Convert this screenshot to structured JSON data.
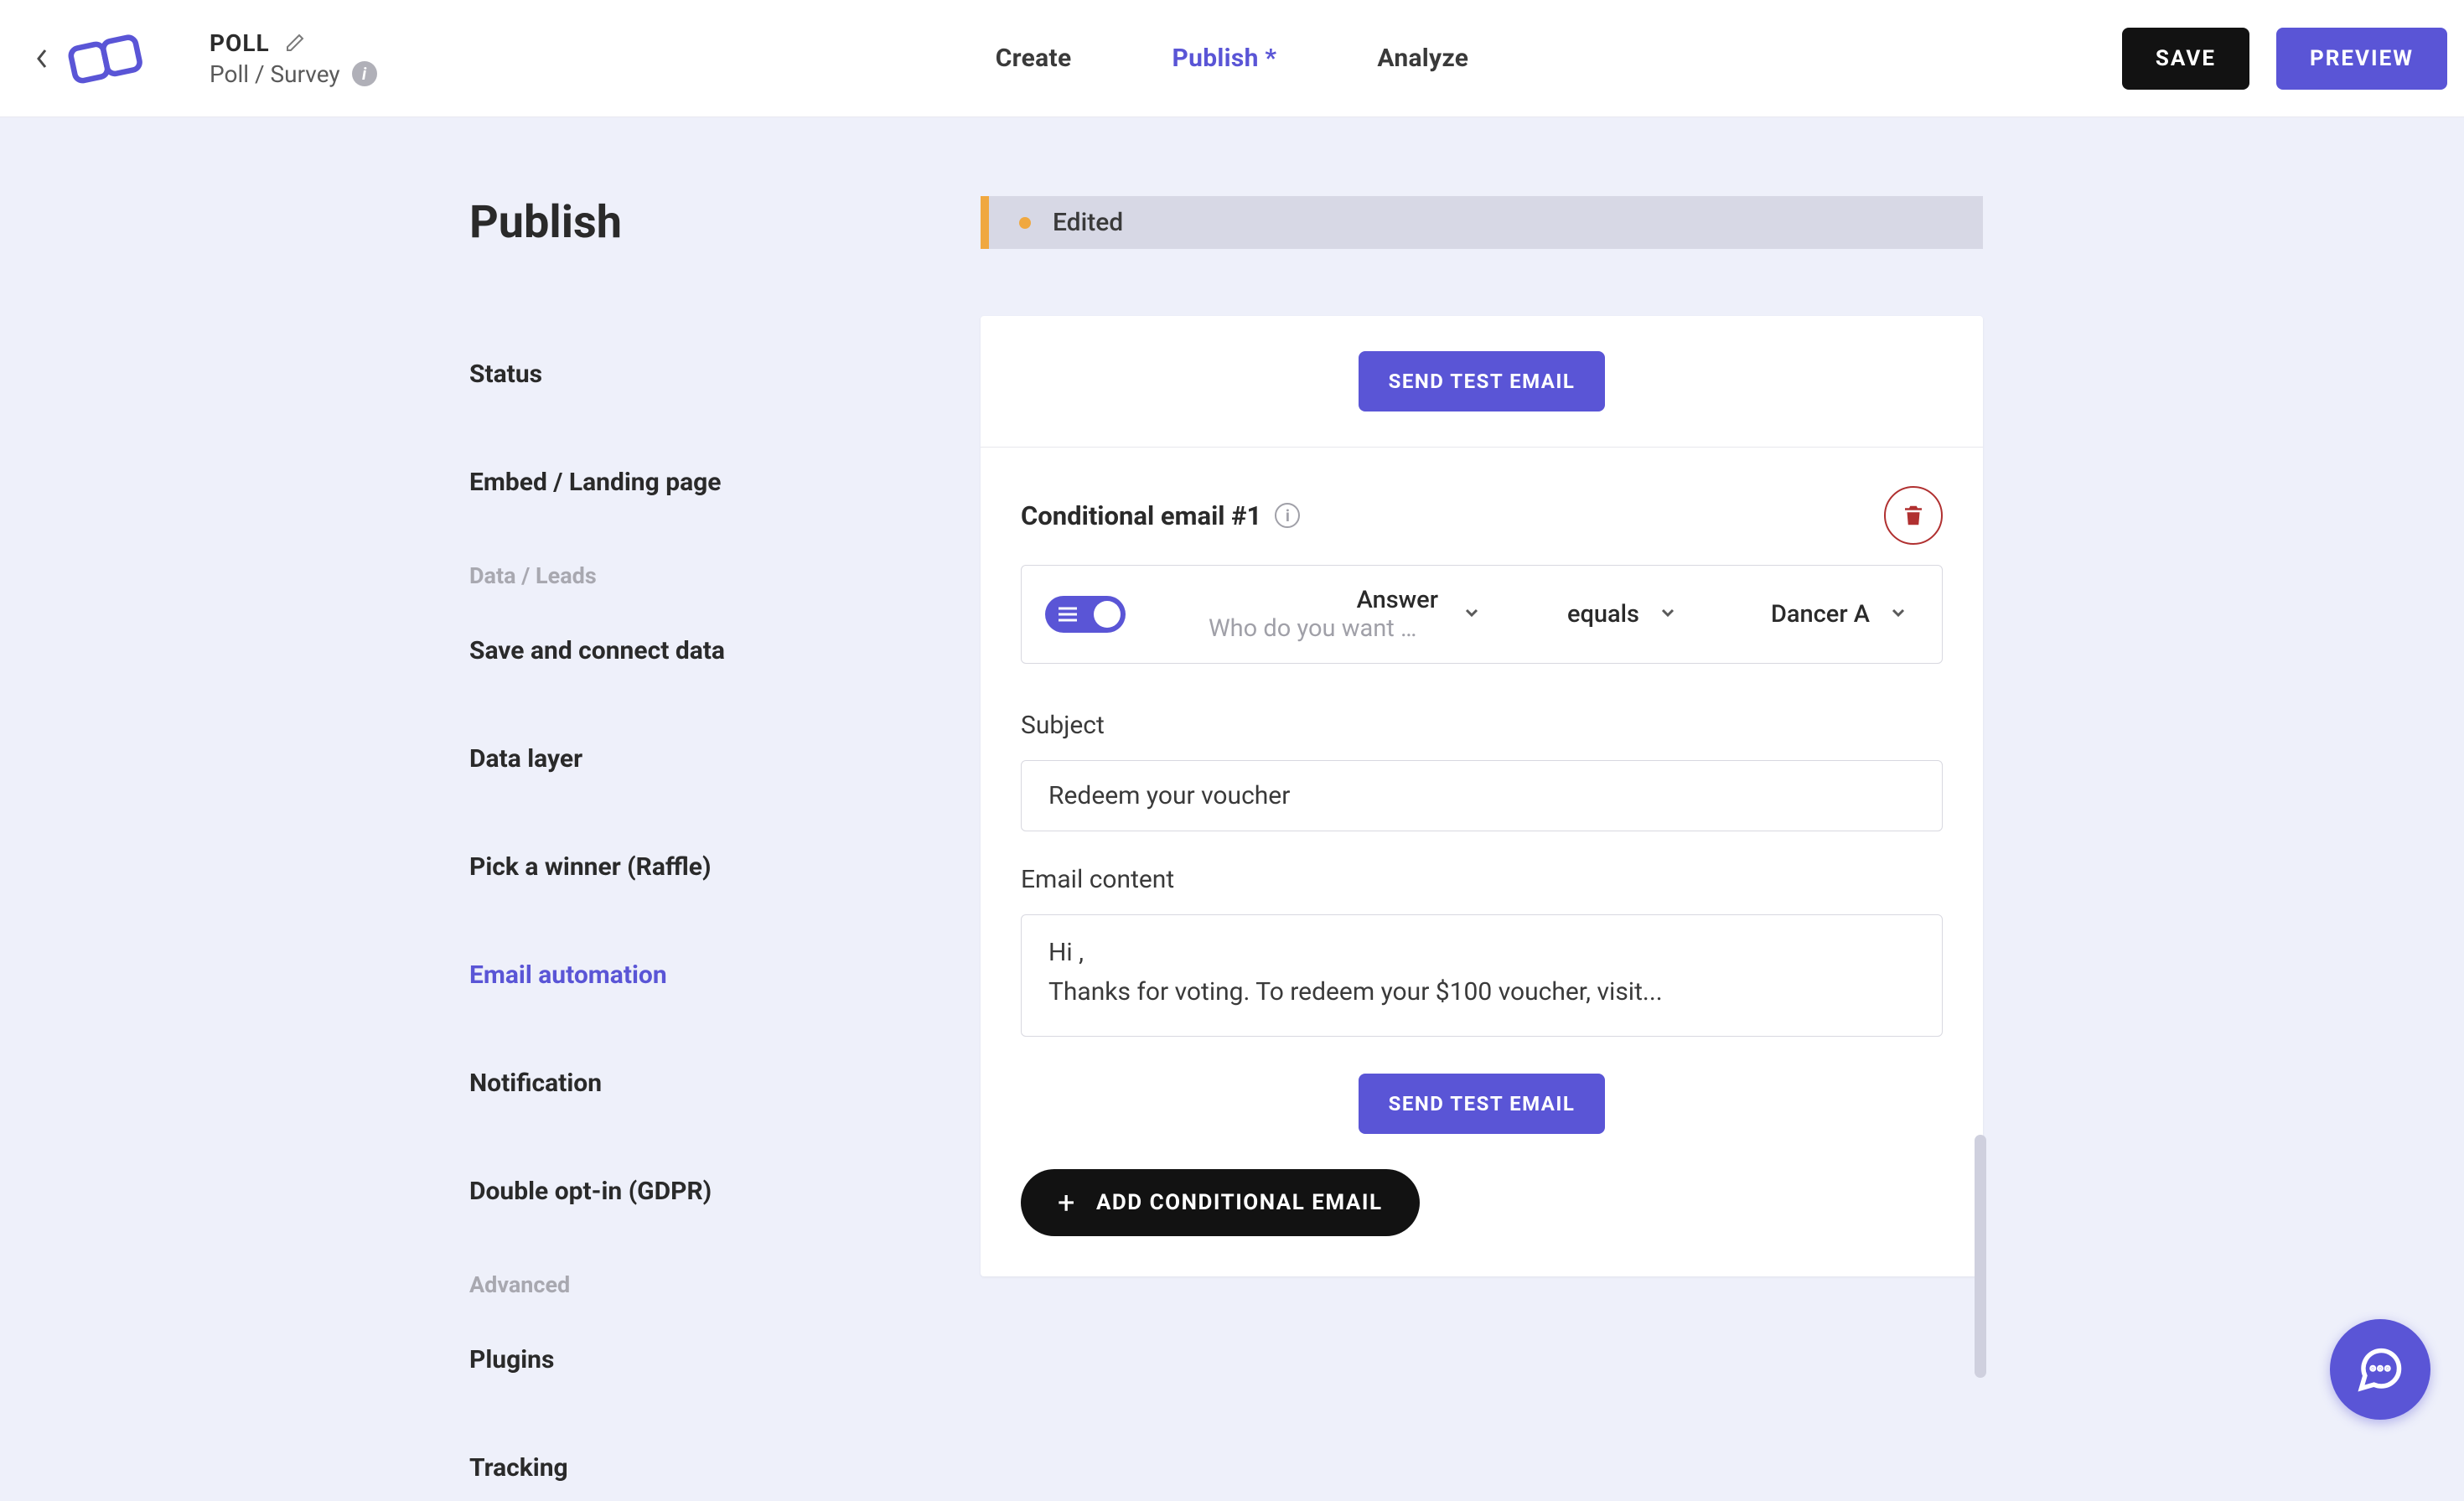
{
  "header": {
    "title": "POLL",
    "subtitle": "Poll / Survey",
    "nav": {
      "create": "Create",
      "publish": "Publish *",
      "analyze": "Analyze"
    },
    "save_label": "SAVE",
    "preview_label": "PREVIEW"
  },
  "sidebar": {
    "title": "Publish",
    "items": {
      "status": "Status",
      "embed": "Embed / Landing page",
      "save_connect": "Save and connect data",
      "data_layer": "Data layer",
      "raffle": "Pick a winner (Raffle)",
      "email_automation": "Email automation",
      "notification": "Notification",
      "double_optin": "Double opt-in (GDPR)",
      "plugins": "Plugins",
      "tracking": "Tracking"
    },
    "groups": {
      "data_leads": "Data / Leads",
      "advanced": "Advanced"
    }
  },
  "status_banner": {
    "label": "Edited"
  },
  "conditional_email": {
    "title": "Conditional email #1",
    "test_btn": "SEND TEST EMAIL",
    "logic": {
      "field_label": "Answer",
      "field_sub": "Who do you want …",
      "operator": "equals",
      "value": "Dancer A"
    },
    "subject_label": "Subject",
    "subject_value": "Redeem your voucher",
    "content_label": "Email content",
    "content_value": "Hi ,\nThanks for voting. To redeem your $100 voucher, visit...",
    "add_btn": "ADD CONDITIONAL EMAIL"
  }
}
